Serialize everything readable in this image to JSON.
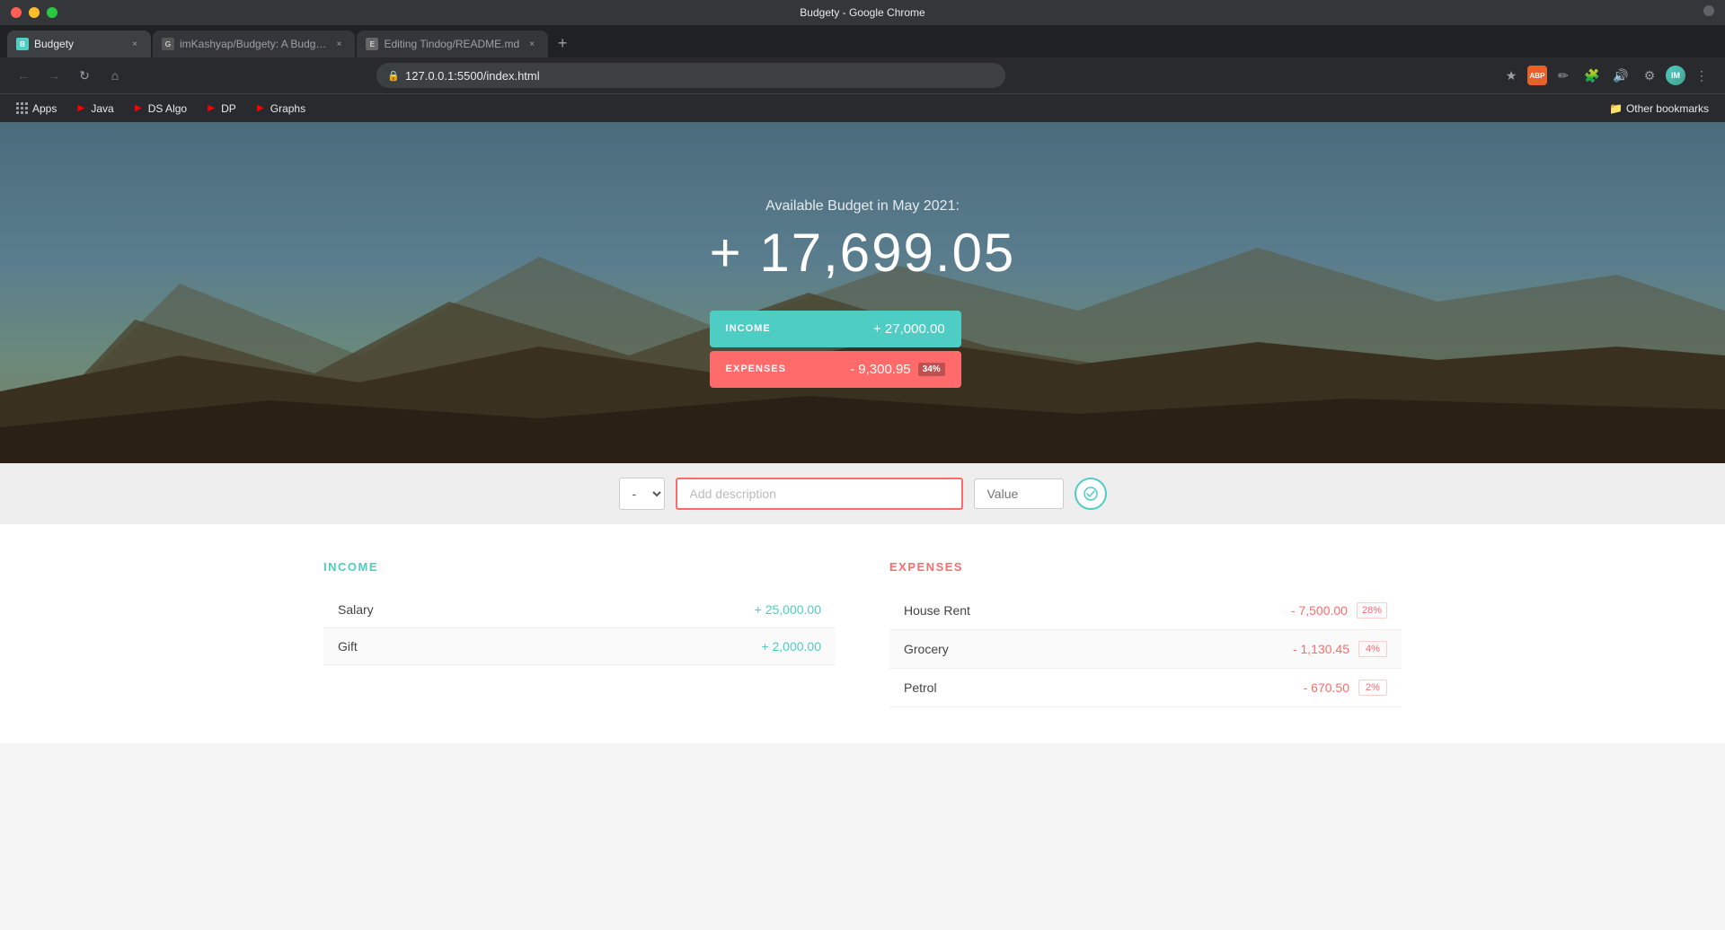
{
  "window": {
    "title": "Budgety - Google Chrome"
  },
  "tabs": [
    {
      "id": "tab1",
      "label": "Budgety",
      "active": true,
      "favicon": "B"
    },
    {
      "id": "tab2",
      "label": "imKashyap/Budgety: A Budg…",
      "active": false,
      "favicon": "G"
    },
    {
      "id": "tab3",
      "label": "Editing Tindog/README.md",
      "active": false,
      "favicon": "E"
    }
  ],
  "address_bar": {
    "url": "127.0.0.1:5500/index.html"
  },
  "bookmarks": [
    {
      "id": "apps",
      "label": "Apps",
      "type": "apps"
    },
    {
      "id": "java",
      "label": "Java",
      "type": "youtube"
    },
    {
      "id": "ds-algo",
      "label": "DS Algo",
      "type": "youtube"
    },
    {
      "id": "dp",
      "label": "DP",
      "type": "youtube"
    },
    {
      "id": "graphs",
      "label": "Graphs",
      "type": "youtube"
    }
  ],
  "other_bookmarks": "Other bookmarks",
  "hero": {
    "label": "Available Budget in May 2021:",
    "amount": "+ 17,699.05",
    "income_label": "INCOME",
    "income_value": "+ 27,000.00",
    "expenses_label": "EXPENSES",
    "expenses_value": "- 9,300.95",
    "expenses_pct": "34%"
  },
  "input": {
    "type_default": "-",
    "description_placeholder": "Add description",
    "value_placeholder": "Value"
  },
  "income_section": {
    "title": "INCOME",
    "items": [
      {
        "name": "Salary",
        "value": "+ 25,000.00"
      },
      {
        "name": "Gift",
        "value": "+ 2,000.00"
      }
    ]
  },
  "expenses_section": {
    "title": "EXPENSES",
    "items": [
      {
        "name": "House Rent",
        "value": "- 7,500.00",
        "pct": "28%"
      },
      {
        "name": "Grocery",
        "value": "- 1,130.45",
        "pct": "4%"
      },
      {
        "name": "Petrol",
        "value": "- 670.50",
        "pct": "2%"
      }
    ]
  }
}
